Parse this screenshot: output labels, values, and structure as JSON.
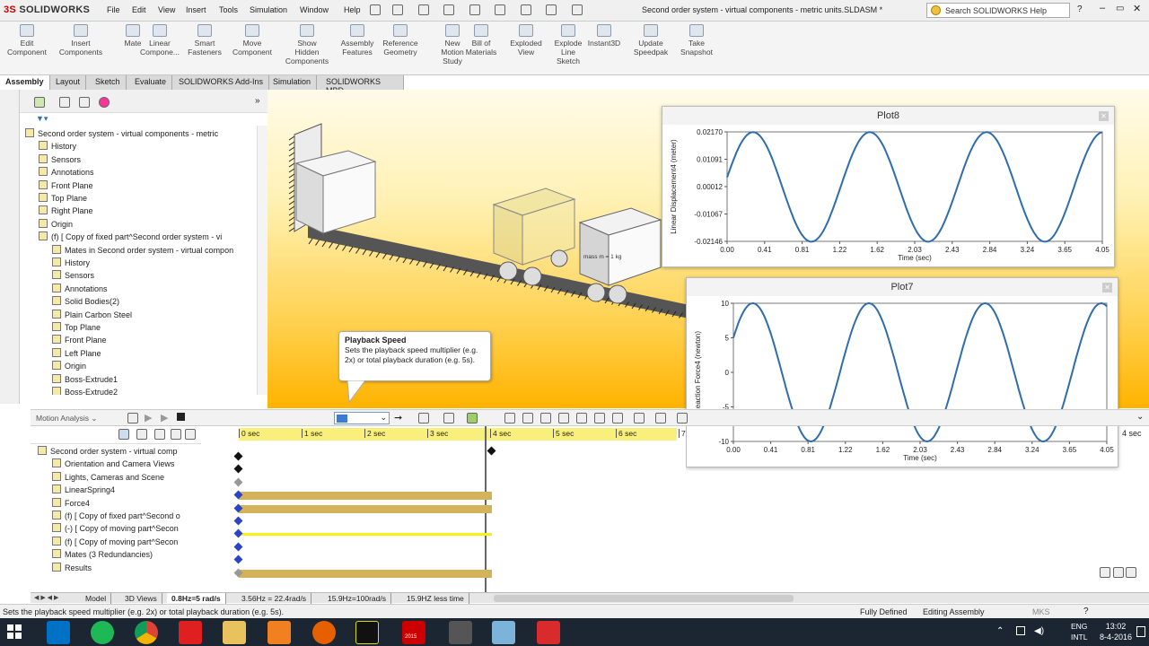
{
  "app": {
    "logo_ds": "3S",
    "logo_name": "SOLIDWORKS",
    "document_title": "Second order system - virtual components - metric units.SLDASM *",
    "help_search_placeholder": "Search SOLIDWORKS Help"
  },
  "menu": [
    "File",
    "Edit",
    "View",
    "Insert",
    "Tools",
    "Simulation",
    "Window",
    "Help"
  ],
  "ribbon": [
    {
      "label": "Edit\nComponent"
    },
    {
      "label": "Insert\nComponents"
    },
    {
      "label": "Mate"
    },
    {
      "label": "Linear\nCompone..."
    },
    {
      "label": "Smart\nFasteners"
    },
    {
      "label": "Move\nComponent"
    },
    {
      "label": "Show\nHidden\nComponents"
    },
    {
      "label": "Assembly\nFeatures"
    },
    {
      "label": "Reference\nGeometry"
    },
    {
      "label": "New\nMotion\nStudy"
    },
    {
      "label": "Bill of\nMaterials"
    },
    {
      "label": "Exploded\nView"
    },
    {
      "label": "Explode\nLine\nSketch"
    },
    {
      "label": "Instant3D"
    },
    {
      "label": "Update\nSpeedpak"
    },
    {
      "label": "Take\nSnapshot"
    }
  ],
  "tabs": [
    "Assembly",
    "Layout",
    "Sketch",
    "Evaluate",
    "SOLIDWORKS Add-Ins",
    "Simulation",
    "SOLIDWORKS MBD"
  ],
  "feature_tree": [
    {
      "label": "Second order system - virtual components - metric",
      "indent": 0
    },
    {
      "label": "History",
      "indent": 1
    },
    {
      "label": "Sensors",
      "indent": 1
    },
    {
      "label": "Annotations",
      "indent": 1
    },
    {
      "label": "Front Plane",
      "indent": 1
    },
    {
      "label": "Top Plane",
      "indent": 1
    },
    {
      "label": "Right Plane",
      "indent": 1
    },
    {
      "label": "Origin",
      "indent": 1
    },
    {
      "label": "(f) [ Copy of fixed part^Second order system - vi",
      "indent": 1
    },
    {
      "label": "Mates in Second order system - virtual compon",
      "indent": 2
    },
    {
      "label": "History",
      "indent": 2
    },
    {
      "label": "Sensors",
      "indent": 2
    },
    {
      "label": "Annotations",
      "indent": 2
    },
    {
      "label": "Solid Bodies(2)",
      "indent": 2
    },
    {
      "label": "Plain Carbon Steel",
      "indent": 2
    },
    {
      "label": "Top Plane",
      "indent": 2
    },
    {
      "label": "Front Plane",
      "indent": 2
    },
    {
      "label": "Left Plane",
      "indent": 2
    },
    {
      "label": "Origin",
      "indent": 2
    },
    {
      "label": "Boss-Extrude1",
      "indent": 2
    },
    {
      "label": "Boss-Extrude2",
      "indent": 2
    }
  ],
  "scene": {
    "mass_label": "mass m = 1 kg"
  },
  "plot8": {
    "title": "Plot8",
    "chart_data": {
      "type": "line",
      "xlabel": "Time (sec)",
      "ylabel": "Linear Displacement4 (meter)",
      "x_ticks": [
        "0.00",
        "0.41",
        "0.81",
        "1.22",
        "1.62",
        "2.03",
        "2.43",
        "2.84",
        "3.24",
        "3.65",
        "4.05"
      ],
      "y_ticks": [
        "0.02170",
        "0.01091",
        "0.00012",
        "-0.01067",
        "-0.02146"
      ],
      "xlim": [
        0,
        4.05
      ],
      "ylim": [
        -0.02146,
        0.0217
      ],
      "series": [
        {
          "amplitude": 0.0216,
          "period": 1.26,
          "phase_shift": 0.07
        }
      ]
    }
  },
  "plot7": {
    "title": "Plot7",
    "chart_data": {
      "type": "line",
      "xlabel": "Time (sec)",
      "ylabel": "Reaction Force4 (newton)",
      "x_ticks": [
        "0.00",
        "0.41",
        "0.81",
        "1.22",
        "1.62",
        "2.03",
        "2.43",
        "2.84",
        "3.24",
        "3.65",
        "4.05"
      ],
      "y_ticks": [
        "10",
        "5",
        "0",
        "-5",
        "-10"
      ],
      "xlim": [
        0,
        4.05
      ],
      "ylim": [
        -10,
        10
      ],
      "series": [
        {
          "amplitude": 10,
          "period": 1.26,
          "phase_shift": 0.0
        }
      ]
    }
  },
  "tooltip": {
    "title": "Playback Speed",
    "text": "Sets the playback speed multiplier (e.g. 2x) or total playback duration (e.g. 5s)."
  },
  "motion": {
    "study_type": "Motion Analysis",
    "tree": [
      {
        "label": "Second order system - virtual comp",
        "indent": 0
      },
      {
        "label": "Orientation and Camera Views",
        "indent": 1
      },
      {
        "label": "Lights, Cameras and Scene",
        "indent": 1
      },
      {
        "label": "LinearSpring4",
        "indent": 1
      },
      {
        "label": "Force4",
        "indent": 1
      },
      {
        "label": "(f) [ Copy of fixed part^Second o",
        "indent": 1
      },
      {
        "label": "(-) [ Copy of moving part^Secon",
        "indent": 1
      },
      {
        "label": "(f) [ Copy of moving part^Secon",
        "indent": 1
      },
      {
        "label": "Mates (3 Redundancies)",
        "indent": 1
      },
      {
        "label": "Results",
        "indent": 1
      }
    ],
    "time_labels": [
      "0 sec",
      "1 sec",
      "2 sec",
      "3 sec",
      "4 sec",
      "5 sec",
      "6 sec",
      "7"
    ],
    "right_time_label": "4 sec"
  },
  "bottom_tabs": [
    "Model",
    "3D Views",
    "0.8Hz=5 rad/s",
    "3.56Hz = 22.4rad/s",
    "15.9Hz=100rad/s",
    "15.9HZ less time"
  ],
  "status": {
    "left": "Sets the playback speed multiplier (e.g. 2x) or total playback duration (e.g. 5s).",
    "fully_defined": "Fully Defined",
    "editing": "Editing Assembly",
    "units": "MKS"
  },
  "taskbar": {
    "lang1": "ENG",
    "lang2": "INTL",
    "time": "13:02",
    "date": "8-4-2016",
    "app_badge": "2015"
  }
}
